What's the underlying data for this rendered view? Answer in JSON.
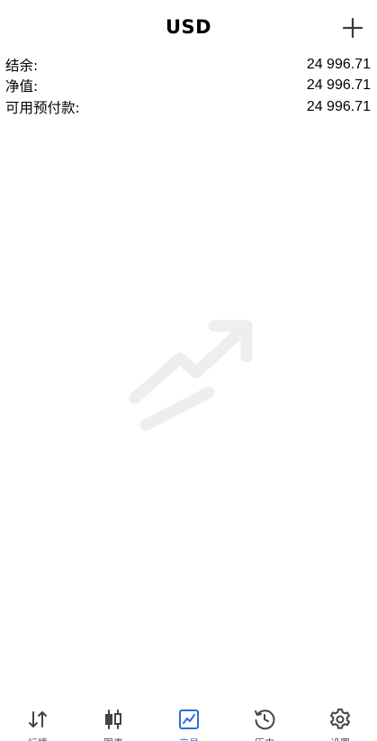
{
  "header": {
    "title": "USD"
  },
  "summary": {
    "rows": [
      {
        "label": "结余:",
        "value": "24 996.71"
      },
      {
        "label": "净值:",
        "value": "24 996.71"
      },
      {
        "label": "可用预付款:",
        "value": "24 996.71"
      }
    ]
  },
  "empty_state": {
    "icon": "trade-chart-icon"
  },
  "tabbar": {
    "tabs": [
      {
        "label": "行情",
        "icon": "quotes-arrows-icon"
      },
      {
        "label": "图表",
        "icon": "candlestick-icon"
      },
      {
        "label": "交易",
        "icon": "trade-chart-icon",
        "active": true
      },
      {
        "label": "历史",
        "icon": "history-clock-icon"
      },
      {
        "label": "设置",
        "icon": "gear-icon"
      }
    ]
  },
  "colors": {
    "accent": "#2a6fd6",
    "tab_inactive": "#444444",
    "illustration": "#eeeeee"
  }
}
